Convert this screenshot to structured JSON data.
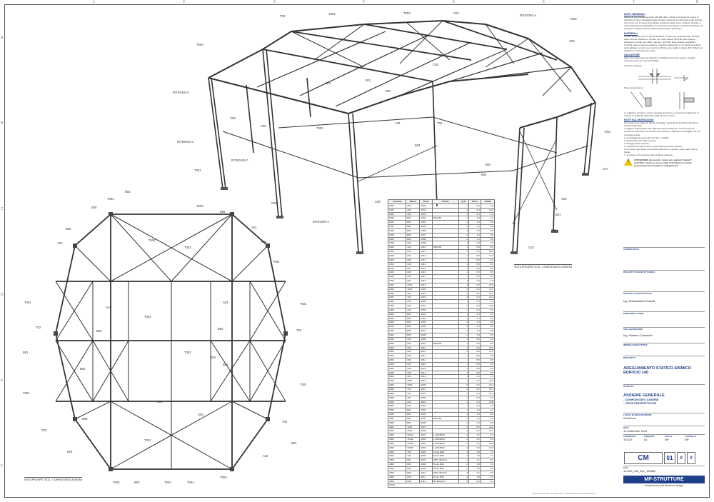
{
  "sheet": {
    "columns": [
      "1",
      "2",
      "3",
      "4",
      "5",
      "6",
      "7",
      "8"
    ],
    "rows": [
      "A",
      "B",
      "C",
      "D",
      "E",
      "F"
    ]
  },
  "views": {
    "top_caption": "VISTA PROSPETTICA - COMPLESSIVO ASSIEMI",
    "bottom_caption": "VISTA PROSPETTICA - COMPLESSIVO ASSIEMI"
  },
  "labels_top": {
    "T03": "T03",
    "T003": "T003",
    "T003b": "T003",
    "C04a": "C04",
    "RITEGNO_A": "RITEGNO-A",
    "T003c": "T003",
    "T003d": "T003",
    "C05": "C05",
    "C06": "C06",
    "RITEGNO_Ca": "RITEGNO-C",
    "C03": "C03",
    "B01": "B01",
    "B02": "B02",
    "C03b": "C03",
    "C08": "C08",
    "RITEGNO_Cb": "RITEGNO-C",
    "T001": "T001",
    "C04": "C04",
    "C09": "C09",
    "RITEGNO_Cc": "RITEGNO-C",
    "T003e": "T003",
    "A03": "A03",
    "T03b": "T03",
    "B04": "B04",
    "B03": "B03",
    "T001b": "T001",
    "C07": "C07",
    "C02": "C02",
    "B01b": "B01",
    "C01": "C01",
    "S01": "S01",
    "C03c": "C03",
    "B02b": "B02"
  },
  "labels_bottom": {
    "T003a": "T003",
    "B03": "B03",
    "T003b": "T003",
    "B05": "B05",
    "B06": "B06",
    "A02": "A02",
    "B04": "B04",
    "T001a": "T001",
    "B02a": "B02",
    "T003c": "T003",
    "A01": "A01",
    "B02b": "B02",
    "T001b": "T001",
    "T02a": "T02",
    "A03": "A03",
    "B01": "B01",
    "T003d": "T003",
    "T02b": "T02",
    "T001c": "T001",
    "B02c": "B02",
    "T003e": "T003",
    "B04b": "B04",
    "T03": "T03",
    "B06b": "B06",
    "B03b": "B03",
    "T003f": "T003",
    "B05b": "B05",
    "A02b": "A02",
    "T001d": "T001"
  },
  "parts_table": {
    "headers": [
      "Assieme",
      "Marca",
      "Parte",
      "Profilo",
      "Q.tà",
      "Peso",
      "Totale"
    ],
    "rows": [
      [
        "1000",
        "A01",
        "1000",
        "",
        "1",
        "5.4",
        "5.4"
      ],
      [
        "1000",
        "A02",
        "1001",
        "",
        "2",
        "5.4",
        "10.8"
      ],
      [
        "1000",
        "A03",
        "1002",
        "",
        "1",
        "5.4",
        "5.4"
      ],
      [
        "1000",
        "B01",
        "1003",
        "HEA160",
        "1",
        "4.3",
        "4.3"
      ],
      [
        "1000",
        "B02",
        "1004",
        "",
        "2",
        "4.3",
        "8.6"
      ],
      [
        "1000",
        "B03",
        "1005",
        "",
        "2",
        "4.3",
        "8.6"
      ],
      [
        "1000",
        "B04",
        "1006",
        "",
        "2",
        "4.3",
        "8.6"
      ],
      [
        "1000",
        "B05",
        "1007",
        "",
        "2",
        "4.3",
        "8.6"
      ],
      [
        "1000",
        "B06",
        "1008",
        "",
        "2",
        "4.3",
        "8.6"
      ],
      [
        "1000",
        "C01",
        "1009",
        "",
        "1",
        "4.3",
        "4.3"
      ],
      [
        "1000",
        "C02",
        "1010",
        "HEA160",
        "1",
        "8.5",
        "8.5"
      ],
      [
        "1000",
        "C03",
        "1011",
        "",
        "3",
        "8.5",
        "25.5"
      ],
      [
        "1000",
        "C04",
        "1012",
        "",
        "2",
        "8.5",
        "17.0"
      ],
      [
        "1000",
        "C05",
        "1013",
        "",
        "1",
        "8.5",
        "8.5"
      ],
      [
        "1000",
        "C06",
        "1014",
        "",
        "1",
        "8.5",
        "8.5"
      ],
      [
        "1000",
        "C07",
        "1015",
        "",
        "1",
        "8.5",
        "8.5"
      ],
      [
        "1000",
        "C08",
        "1016",
        "",
        "1",
        "8.5",
        "8.5"
      ],
      [
        "1000",
        "C09",
        "1017",
        "",
        "1",
        "8.5",
        "8.5"
      ],
      [
        "1000",
        "S01",
        "1018",
        "",
        "1",
        "2.3",
        "2.3"
      ],
      [
        "1000",
        "T001",
        "1019",
        "",
        "4",
        "6.2",
        "24.8"
      ],
      [
        "1000",
        "T003",
        "1020",
        "",
        "6",
        "6.2",
        "37.2"
      ],
      [
        "1000",
        "T02",
        "1021",
        "",
        "2",
        "6.2",
        "12.4"
      ],
      [
        "1000",
        "T03",
        "1022",
        "",
        "2",
        "6.2",
        "12.4"
      ],
      [
        "2000",
        "A01",
        "2000",
        "",
        "1",
        "5.4",
        "5.4"
      ],
      [
        "2000",
        "A02",
        "2001",
        "",
        "2",
        "5.4",
        "10.8"
      ],
      [
        "2000",
        "A03",
        "2002",
        "",
        "1",
        "5.4",
        "5.4"
      ],
      [
        "2000",
        "B01",
        "2003",
        "",
        "1",
        "4.3",
        "4.3"
      ],
      [
        "2000",
        "B02",
        "2004",
        "",
        "2",
        "4.3",
        "8.6"
      ],
      [
        "2000",
        "B03",
        "2005",
        "",
        "2",
        "4.3",
        "8.6"
      ],
      [
        "2000",
        "B04",
        "2006",
        "",
        "2",
        "4.3",
        "8.6"
      ],
      [
        "2000",
        "B05",
        "2007",
        "",
        "2",
        "4.3",
        "8.6"
      ],
      [
        "2000",
        "B06",
        "2008",
        "",
        "2",
        "4.3",
        "8.6"
      ],
      [
        "2000",
        "C01",
        "2009",
        "",
        "1",
        "8.5",
        "8.5"
      ],
      [
        "2000",
        "C02",
        "2010",
        "HEA160",
        "1",
        "8.5",
        "8.5"
      ],
      [
        "2000",
        "C03",
        "2011",
        "",
        "3",
        "8.5",
        "25.5"
      ],
      [
        "2000",
        "C04",
        "2012",
        "",
        "2",
        "8.5",
        "17.0"
      ],
      [
        "2000",
        "C05",
        "2013",
        "",
        "1",
        "8.5",
        "8.5"
      ],
      [
        "2000",
        "C06",
        "2014",
        "",
        "1",
        "8.5",
        "8.5"
      ],
      [
        "2000",
        "C07",
        "2015",
        "",
        "1",
        "8.5",
        "8.5"
      ],
      [
        "2000",
        "C08",
        "2016",
        "",
        "1",
        "8.5",
        "8.5"
      ],
      [
        "2000",
        "C09",
        "2017",
        "",
        "1",
        "8.5",
        "8.5"
      ],
      [
        "2000",
        "S01",
        "2018",
        "",
        "1",
        "2.3",
        "2.3"
      ],
      [
        "2000",
        "T001",
        "2019",
        "",
        "4",
        "6.2",
        "24.8"
      ],
      [
        "2000",
        "T003",
        "2020",
        "",
        "6",
        "6.2",
        "37.2"
      ],
      [
        "2000",
        "T02",
        "2021",
        "",
        "2",
        "6.2",
        "12.4"
      ],
      [
        "2000",
        "T03",
        "2022",
        "",
        "2",
        "6.2",
        "12.4"
      ],
      [
        "3000",
        "A01",
        "3000",
        "",
        "1",
        "5.4",
        "5.4"
      ],
      [
        "3000",
        "A02",
        "3001",
        "",
        "2",
        "5.4",
        "10.8"
      ],
      [
        "3000",
        "A03",
        "3002",
        "",
        "1",
        "5.4",
        "5.4"
      ],
      [
        "3000",
        "B01",
        "3003",
        "",
        "1",
        "4.3",
        "4.3"
      ],
      [
        "3000",
        "B02",
        "3004",
        "",
        "2",
        "4.3",
        "8.6"
      ],
      [
        "3000",
        "B03",
        "3005",
        "HEA160",
        "2",
        "4.3",
        "8.6"
      ],
      [
        "3000",
        "B04",
        "3006",
        "",
        "2",
        "4.3",
        "8.6"
      ],
      [
        "3000",
        "T001",
        "3007",
        "",
        "4",
        "6.2",
        "24.8"
      ],
      [
        "3000",
        "T003",
        "3008",
        "",
        "6",
        "6.2",
        "37.2"
      ],
      [
        "4000",
        "T001a",
        "4001",
        "L 120x80x8",
        "2",
        "3.2",
        "6.4"
      ],
      [
        "4000",
        "T001b",
        "4002",
        "L 120x80x8",
        "2",
        "3.2",
        "6.4"
      ],
      [
        "4000",
        "T003a",
        "4003",
        "L 120x80x8",
        "4",
        "3.2",
        "12.8"
      ],
      [
        "4000",
        "T003b",
        "4004",
        "L 120x80x8",
        "4",
        "3.2",
        "12.8"
      ],
      [
        "4000",
        "T02",
        "4005",
        "Tondo Ø20",
        "4",
        "1.8",
        "7.2"
      ],
      [
        "4000",
        "T03",
        "4006",
        "Tondo Ø20",
        "4",
        "1.8",
        "7.2"
      ],
      [
        "4000",
        "R01",
        "4007",
        "UPN 100 Part.",
        "2",
        "4.1",
        "8.2"
      ],
      [
        "4000",
        "R02",
        "4008",
        "Tondo Ø20",
        "2",
        "1.8",
        "3.6"
      ],
      [
        "4000",
        "R03",
        "4009",
        "Tondo Ø20",
        "2",
        "1.8",
        "3.6"
      ],
      [
        "4000",
        "R04",
        "4010",
        "UPN 100 Part.",
        "2",
        "4.1",
        "8.2"
      ],
      [
        "4000",
        "R05",
        "4011",
        "Tondo Ø20",
        "2",
        "1.8",
        "3.6"
      ],
      [
        "4000",
        "R06",
        "4012",
        "RITEGNO-C",
        "2",
        "2.2",
        "4.4"
      ]
    ],
    "total_label": "Totale"
  },
  "notes": {
    "general_title": "NOTE GENERALI",
    "general_text": "Classe di esecuzione secondo UNI EN 1090 - EXC2. L'impresa ha l'onere di effettuare il rilievo dettagliato delle strutture esistenti, in particolare delle strutture sotto tiene con lo scopo di verificare l'esigenza delle nuove strutture. Rimane a carico dell'impresa appaltatrice la redazione del progetto costruttivo d'officina, da sottoporre all'approvazione della direzione lavori strutturale.",
    "materials_title": "MATERIALI",
    "materials_text": "Acciaio secondo Norma UNI EN 10025-2. Acciaio per profili laminati: S275JR salvo diverse indicazioni. Acciaio per profili saldati: S275JR salvo diverse indicazioni. Acciaio per piatti e lamiere: S275JR, salvo diverse indicazioni. Controlli visivi su tutte le saldature. Controlli radiografici o con liquidi penetranti sulle saldature a piena penetrazione. Bulloneria a taglio in classe 8.8. Bulloni per saldature e rinforzamento bordo.",
    "welding_title": "SALDATURE",
    "welding_text": "salvo dove diversamente indicato, le saldature dovranno essere eseguite conformemente ai seguenti dettagli:",
    "angle_title": "Cordone d'angolo:",
    "pen_title": "Piena penetrazione:",
    "welding_note": "Le saldature dovranno essere eseguite da tecnici e secondo le indicazioni di metodo di saldatura approvate dalla direzione lavori.",
    "assembly_title": "NOTE SUL MONTAGGIO",
    "assembly_text": "Si prevedono le seguenti fasi di montaggio, ipotizzando di iniziare dal lato di controventamento:",
    "steps": [
      "1. leggero sollevamento del solaio del tetto di alluminio, così lo scopo di sostenere i pannelli e consentirne la rimozione. Utilizzare un fissaggio che non coinvolga il tetto;",
      "2. smontaggio dei pannelli (non fissi e visibili);",
      "3. posizionamento delle colonne;",
      "4. fissaggio delle colonne;",
      "5. sollevamento della trave e posizionamento delle colonne;",
      "6. rimozione dei ritegni temporanei sulle travi e messa in opera delle travi e bulloni;",
      "7. rimozione del sostegno della struttura esistente."
    ],
    "warning": "ATTENZIONE: gli assiemi, anche se/o parziali \"ripetuti\", potrebbero avere lo stesso sigla. Controllare il corretto posizionamento dei piatti di collegamento."
  },
  "title_block": {
    "client_label": "COMMITTENTE",
    "client": "",
    "arch_label": "PROGETTO ARCHITETTONICO",
    "arch": "",
    "struct_label": "PROGETTO STRUTTURALE",
    "struct": "Ing. Massimiliano Pratelli",
    "dl_label": "DIREZIONE LAVORI",
    "dl": "",
    "collab_label": "COLLABORATORE",
    "collab": "Ing. Stefano Colombini",
    "impresa_label": "IMPRESA ESECUTRICE",
    "impresa": "",
    "project_label": "PROGETTO",
    "project": "ADEGUAMENTO STATICO-SISMICO EDIFICIO 140",
    "subject_label": "OGGETTO",
    "subject": "ASSIEME GENERALE",
    "subject_lines": [
      "- COMPLESSIVO ASSIEMI",
      "- VISTE PROSPETTICHE"
    ],
    "place_label": "LUOGO DI REALIZZAZIONE",
    "place": "Sesto/ora",
    "date_label": "DATA",
    "date": "12 settembre 2019",
    "job_label": "COMMESSA",
    "job": "19-023",
    "format_label": "FORMATO",
    "format": "A1",
    "scale_label": "SCALA",
    "scale": "NP",
    "sheet_label": "CARTELLA",
    "sheet": "NP",
    "code_cm": "CM",
    "code_01": "01",
    "code_0a": "0",
    "code_0b": "0",
    "file_label": "FILE",
    "file": "19-023_CM_001_190830",
    "logo": "MP-STRUTTURE",
    "logo_sub": "Industrial and civil structures design"
  },
  "footer": "Tutti i diritti riservati - all' elaborato è proprietà esclusiva di MP Strutture"
}
